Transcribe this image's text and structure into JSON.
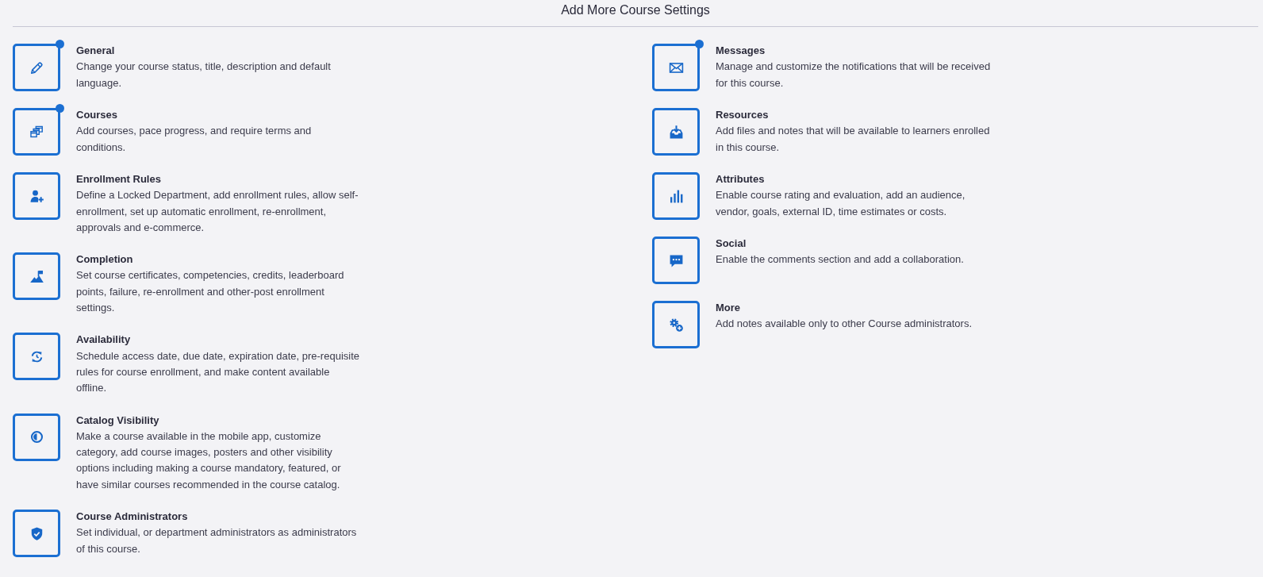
{
  "title": "Add More Course Settings",
  "columns": [
    {
      "items": [
        {
          "title": "General",
          "description": "Change your course status, title, description and default language.",
          "indicator": true
        },
        {
          "title": "Courses",
          "description": "Add courses, pace progress, and require terms and conditions.",
          "indicator": true
        },
        {
          "title": "Enrollment Rules",
          "description": "Define a Locked Department, add enrollment rules, allow self-enrollment, set up automatic enrollment, re-enrollment, approvals and e-commerce.",
          "indicator": false
        },
        {
          "title": "Completion",
          "description": "Set course certificates, competencies, credits, leaderboard points, failure, re-enrollment and other-post enrollment settings.",
          "indicator": false
        },
        {
          "title": "Availability",
          "description": "Schedule access date, due date, expiration date, pre-requisite rules for course enrollment, and make content available offline.",
          "indicator": false
        },
        {
          "title": "Catalog Visibility",
          "description": "Make a course available in the mobile app, customize category, add course images, posters and other visibility options including making a course mandatory, featured, or have similar courses recommended in the course catalog.",
          "indicator": false
        },
        {
          "title": "Course Administrators",
          "description": "Set individual, or department administrators as administrators of this course.",
          "indicator": false
        }
      ]
    },
    {
      "items": [
        {
          "title": "Messages",
          "description": "Manage and customize the notifications that will be received for this course.",
          "indicator": true
        },
        {
          "title": "Resources",
          "description": "Add files and notes that will be available to learners enrolled in this course.",
          "indicator": false
        },
        {
          "title": "Attributes",
          "description": "Enable course rating and evaluation, add an audience, vendor, goals, external ID, time estimates or costs.",
          "indicator": false
        },
        {
          "title": "Social",
          "description": "Enable the comments section and add a collaboration.",
          "indicator": false
        },
        {
          "title": "More",
          "description": "Add notes available only to other Course administrators.",
          "indicator": false
        }
      ]
    }
  ]
}
